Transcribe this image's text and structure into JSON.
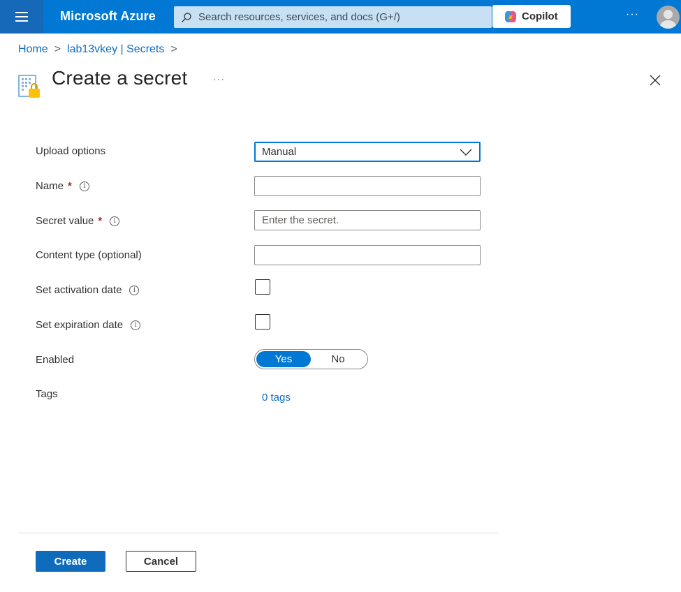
{
  "header": {
    "brand": "Microsoft Azure",
    "search_placeholder": "Search resources, services, and docs (G+/)",
    "copilot_label": "Copilot",
    "more_label": "···"
  },
  "breadcrumb": {
    "items": [
      "Home",
      "lab13vkey | Secrets"
    ],
    "separator": ">"
  },
  "page": {
    "title": "Create a secret",
    "more_label": "···"
  },
  "form": {
    "upload_options": {
      "label": "Upload options",
      "value": "Manual"
    },
    "name": {
      "label": "Name",
      "required": "*",
      "value": "",
      "placeholder": ""
    },
    "secret_value": {
      "label": "Secret value",
      "required": "*",
      "value": "",
      "placeholder": "Enter the secret."
    },
    "content_type": {
      "label": "Content type (optional)",
      "value": "",
      "placeholder": ""
    },
    "activation_date": {
      "label": "Set activation date",
      "checked": false
    },
    "expiration_date": {
      "label": "Set expiration date",
      "checked": false
    },
    "enabled": {
      "label": "Enabled",
      "yes": "Yes",
      "no": "No",
      "selected": "Yes"
    },
    "tags": {
      "label": "Tags",
      "link": "0 tags"
    },
    "info_glyph": "i"
  },
  "footer": {
    "create_label": "Create",
    "cancel_label": "Cancel"
  },
  "colors": {
    "topbar": "#0078d4",
    "hamburger_bg": "#1669b9",
    "search_bg": "#c7e0f4",
    "accent": "#0f6cbd",
    "required": "#a4262c"
  },
  "icons": [
    "hamburger-icon",
    "search-icon",
    "copilot-icon",
    "more-icon",
    "avatar-icon",
    "key-vault-secret-icon",
    "close-icon",
    "info-icon",
    "chevron-down-icon"
  ]
}
